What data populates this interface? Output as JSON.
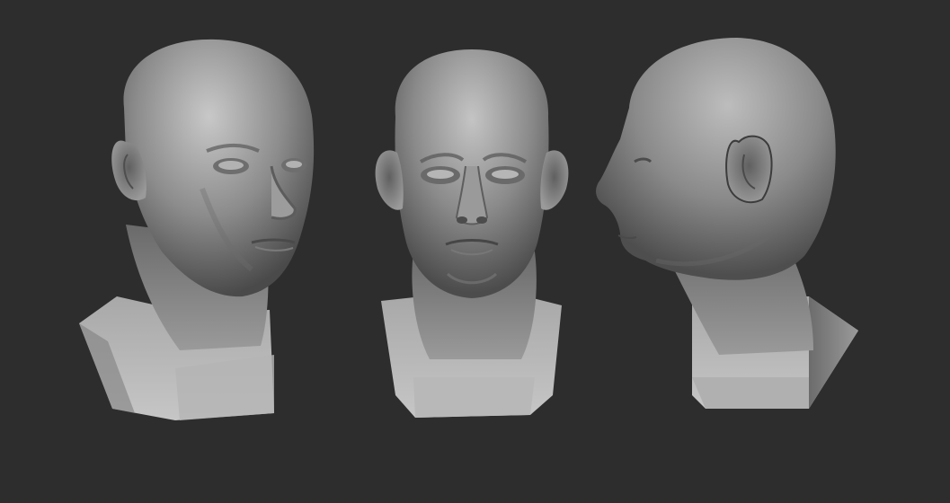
{
  "scene": {
    "background_color": "#2d2d2d",
    "material_color": "#8a8a8a",
    "highlight_color": "#d4d4d4",
    "shadow_color": "#3a3a3a",
    "views": [
      {
        "id": "three-quarter",
        "label": ""
      },
      {
        "id": "front",
        "label": ""
      },
      {
        "id": "profile",
        "label": ""
      }
    ]
  }
}
